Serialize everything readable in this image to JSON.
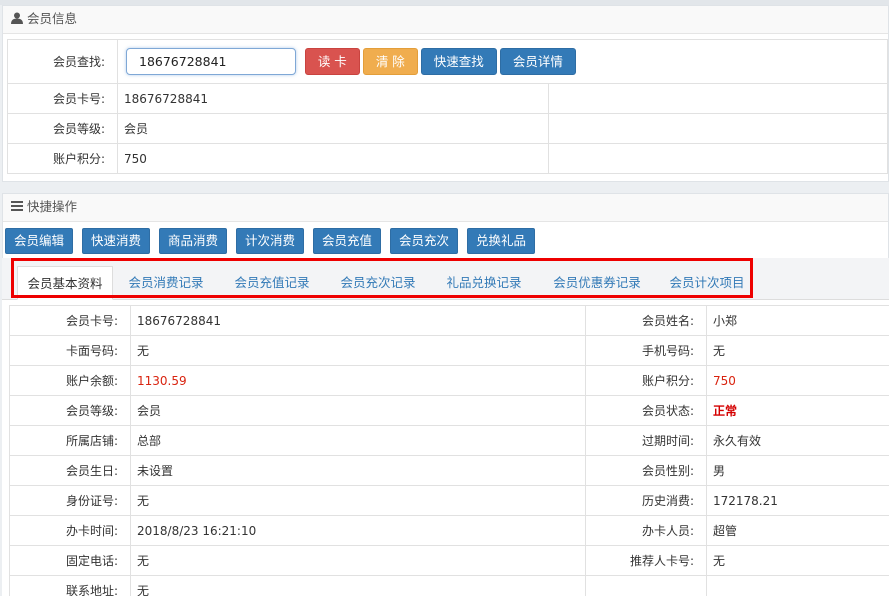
{
  "member_info": {
    "title": "会员信息",
    "search_label": "会员查找:",
    "search_value": "18676728841",
    "buttons": {
      "read_card": "读 卡",
      "clear": "清 除",
      "quick_search": "快速查找",
      "details": "会员详情"
    },
    "rows": [
      {
        "label": "会员卡号:",
        "value": "18676728841"
      },
      {
        "label": "会员等级:",
        "value": "会员"
      },
      {
        "label": "账户积分:",
        "value": "750"
      }
    ]
  },
  "quick_ops": {
    "title": "快捷操作",
    "buttons": [
      "会员编辑",
      "快速消费",
      "商品消费",
      "计次消费",
      "会员充值",
      "会员充次",
      "兑换礼品"
    ]
  },
  "tabs": [
    "会员基本资料",
    "会员消费记录",
    "会员充值记录",
    "会员充次记录",
    "礼品兑换记录",
    "会员优惠券记录",
    "会员计次项目"
  ],
  "active_tab": "会员基本资料",
  "details": [
    {
      "l1": "会员卡号:",
      "v1": "18676728841",
      "l2": "会员姓名:",
      "v2": "小郑"
    },
    {
      "l1": "卡面号码:",
      "v1": "无",
      "l2": "手机号码:",
      "v2": "无"
    },
    {
      "l1": "账户余额:",
      "v1": "1130.59",
      "l2": "账户积分:",
      "v2": "750"
    },
    {
      "l1": "会员等级:",
      "v1": "会员",
      "l2": "会员状态:",
      "v2": "正常"
    },
    {
      "l1": "所属店铺:",
      "v1": "总部",
      "l2": "过期时间:",
      "v2": "永久有效"
    },
    {
      "l1": "会员生日:",
      "v1": "未设置",
      "l2": "会员性别:",
      "v2": "男"
    },
    {
      "l1": "身份证号:",
      "v1": "无",
      "l2": "历史消费:",
      "v2": "172178.21"
    },
    {
      "l1": "办卡时间:",
      "v1": "2018/8/23 16:21:10",
      "l2": "办卡人员:",
      "v2": "超管"
    },
    {
      "l1": "固定电话:",
      "v1": "无",
      "l2": "推荐人卡号:",
      "v2": "无"
    },
    {
      "l1": "联系地址:",
      "v1": "无",
      "l2": "",
      "v2": ""
    }
  ],
  "colors": {
    "primary": "#337ab7",
    "danger": "#d9534f",
    "warning": "#f0ad4e",
    "highlight": "#ee0000",
    "value_red": "#d9230f"
  },
  "icons": {
    "member_info": "user-icon",
    "quick_ops": "list-icon"
  }
}
